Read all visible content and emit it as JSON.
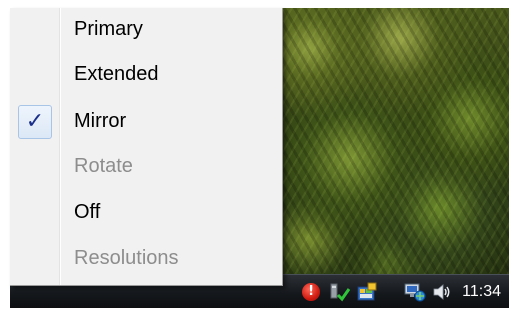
{
  "context_menu": {
    "items": [
      {
        "label": "Primary",
        "enabled": true,
        "checked": false
      },
      {
        "label": "Extended",
        "enabled": true,
        "checked": false
      },
      {
        "label": "Mirror",
        "enabled": true,
        "checked": true
      },
      {
        "label": "Rotate",
        "enabled": false,
        "checked": false
      },
      {
        "label": "Off",
        "enabled": true,
        "checked": false
      },
      {
        "label": "Resolutions",
        "enabled": false,
        "checked": false
      }
    ],
    "check_glyph": "✓"
  },
  "taskbar": {
    "clock": "11:34",
    "tray_icons": [
      "alert-icon",
      "network-check-icon",
      "app-grid-icon",
      "network-icon",
      "volume-icon"
    ],
    "alert_glyph": "!"
  },
  "colors": {
    "menu_background": "#f1f1f1",
    "disabled_text": "#8d8d8d",
    "checkmark": "#1a2f8a",
    "taskbar": "#15181c"
  }
}
